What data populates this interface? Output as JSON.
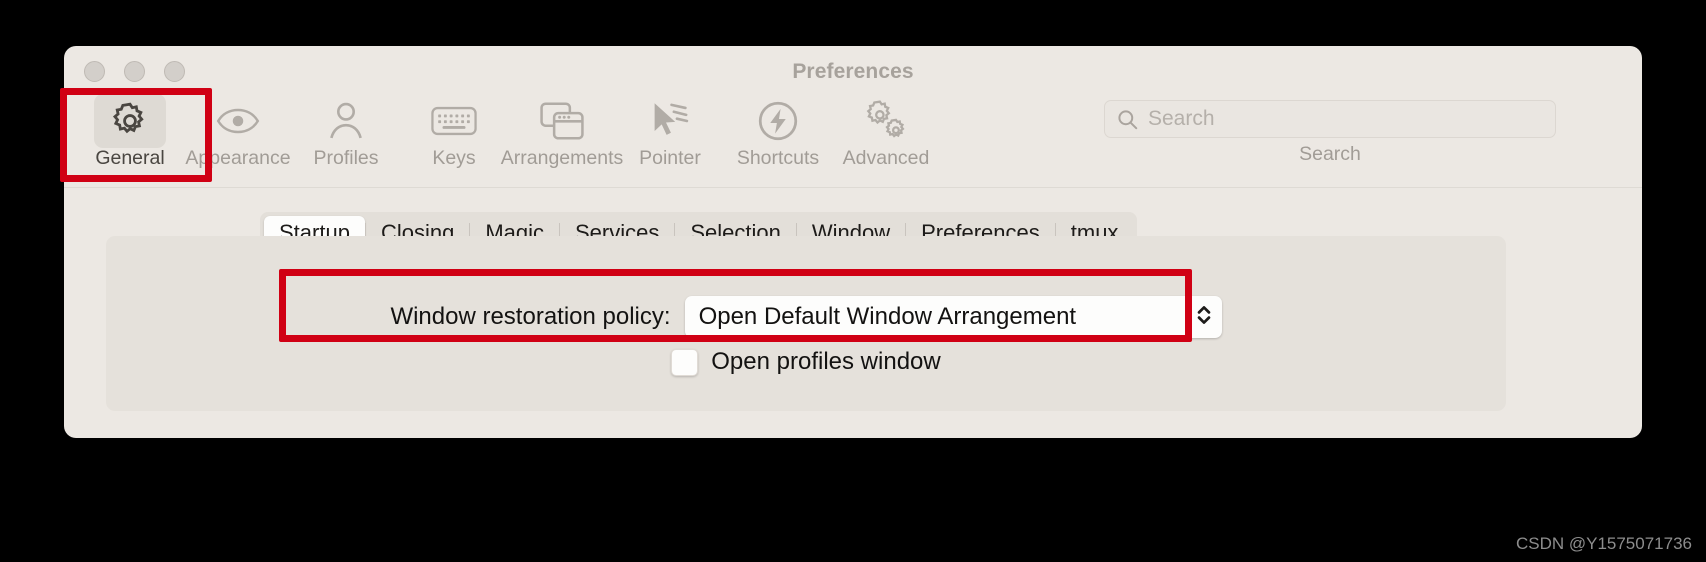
{
  "window": {
    "title": "Preferences",
    "traffic_lights": [
      "close-button",
      "minimize-button",
      "zoom-button"
    ]
  },
  "toolbar": {
    "items": [
      {
        "label": "General",
        "icon": "gear-icon",
        "selected": true
      },
      {
        "label": "Appearance",
        "icon": "eye-icon",
        "selected": false
      },
      {
        "label": "Profiles",
        "icon": "person-icon",
        "selected": false
      },
      {
        "label": "Keys",
        "icon": "keyboard-icon",
        "selected": false
      },
      {
        "label": "Arrangements",
        "icon": "windows-icon",
        "selected": false
      },
      {
        "label": "Pointer",
        "icon": "cursor-icon",
        "selected": false
      },
      {
        "label": "Shortcuts",
        "icon": "bolt-circle-icon",
        "selected": false
      },
      {
        "label": "Advanced",
        "icon": "double-gear-icon",
        "selected": false
      }
    ]
  },
  "search": {
    "icon": "search-icon",
    "placeholder": "Search",
    "value": "",
    "label": "Search"
  },
  "tabs": {
    "items": [
      {
        "label": "Startup",
        "active": true
      },
      {
        "label": "Closing",
        "active": false
      },
      {
        "label": "Magic",
        "active": false
      },
      {
        "label": "Services",
        "active": false
      },
      {
        "label": "Selection",
        "active": false
      },
      {
        "label": "Window",
        "active": false
      },
      {
        "label": "Preferences",
        "active": false
      },
      {
        "label": "tmux",
        "active": false
      }
    ]
  },
  "content": {
    "policy": {
      "label": "Window restoration policy:",
      "value": "Open Default Window Arrangement",
      "stepper_icon": "chevron-up-down-icon"
    },
    "open_profiles": {
      "label": "Open profiles window",
      "checked": false
    }
  },
  "annotations": {
    "color": "#d00014",
    "boxes": [
      "general-tab-highlight",
      "window-restoration-policy-highlight"
    ]
  },
  "watermark": "CSDN @Y1575071736"
}
